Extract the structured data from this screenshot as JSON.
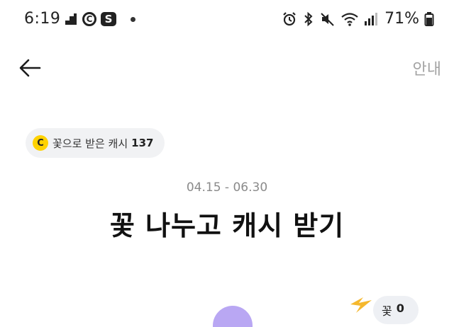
{
  "status_bar": {
    "time": "6:19",
    "battery": "71%",
    "left_icons": [
      "stairs-notification-icon",
      "c-app-icon",
      "s-app-icon",
      "dot-icon"
    ],
    "right_icons": [
      "alarm-icon",
      "bluetooth-icon",
      "mute-icon",
      "wifi-icon",
      "signal-icon",
      "battery-icon"
    ]
  },
  "header": {
    "back_icon": "arrow-left-icon",
    "info_label": "안내"
  },
  "cash_chip": {
    "coin_symbol": "C",
    "label": "꽃으로 받은 캐시",
    "value": "137"
  },
  "event": {
    "period": "04.15 - 06.30",
    "title": "꽃 나누고 캐시 받기"
  },
  "flower_badge": {
    "label": "꽃",
    "count": "0"
  },
  "colors": {
    "coin": "#ffd200",
    "chip_bg": "#f1f2f4",
    "info_text": "#a3a3a3",
    "period_text": "#8a8a8a",
    "illustration_purple": "#b9a7f3",
    "illustration_yellow": "#f5b82e"
  }
}
